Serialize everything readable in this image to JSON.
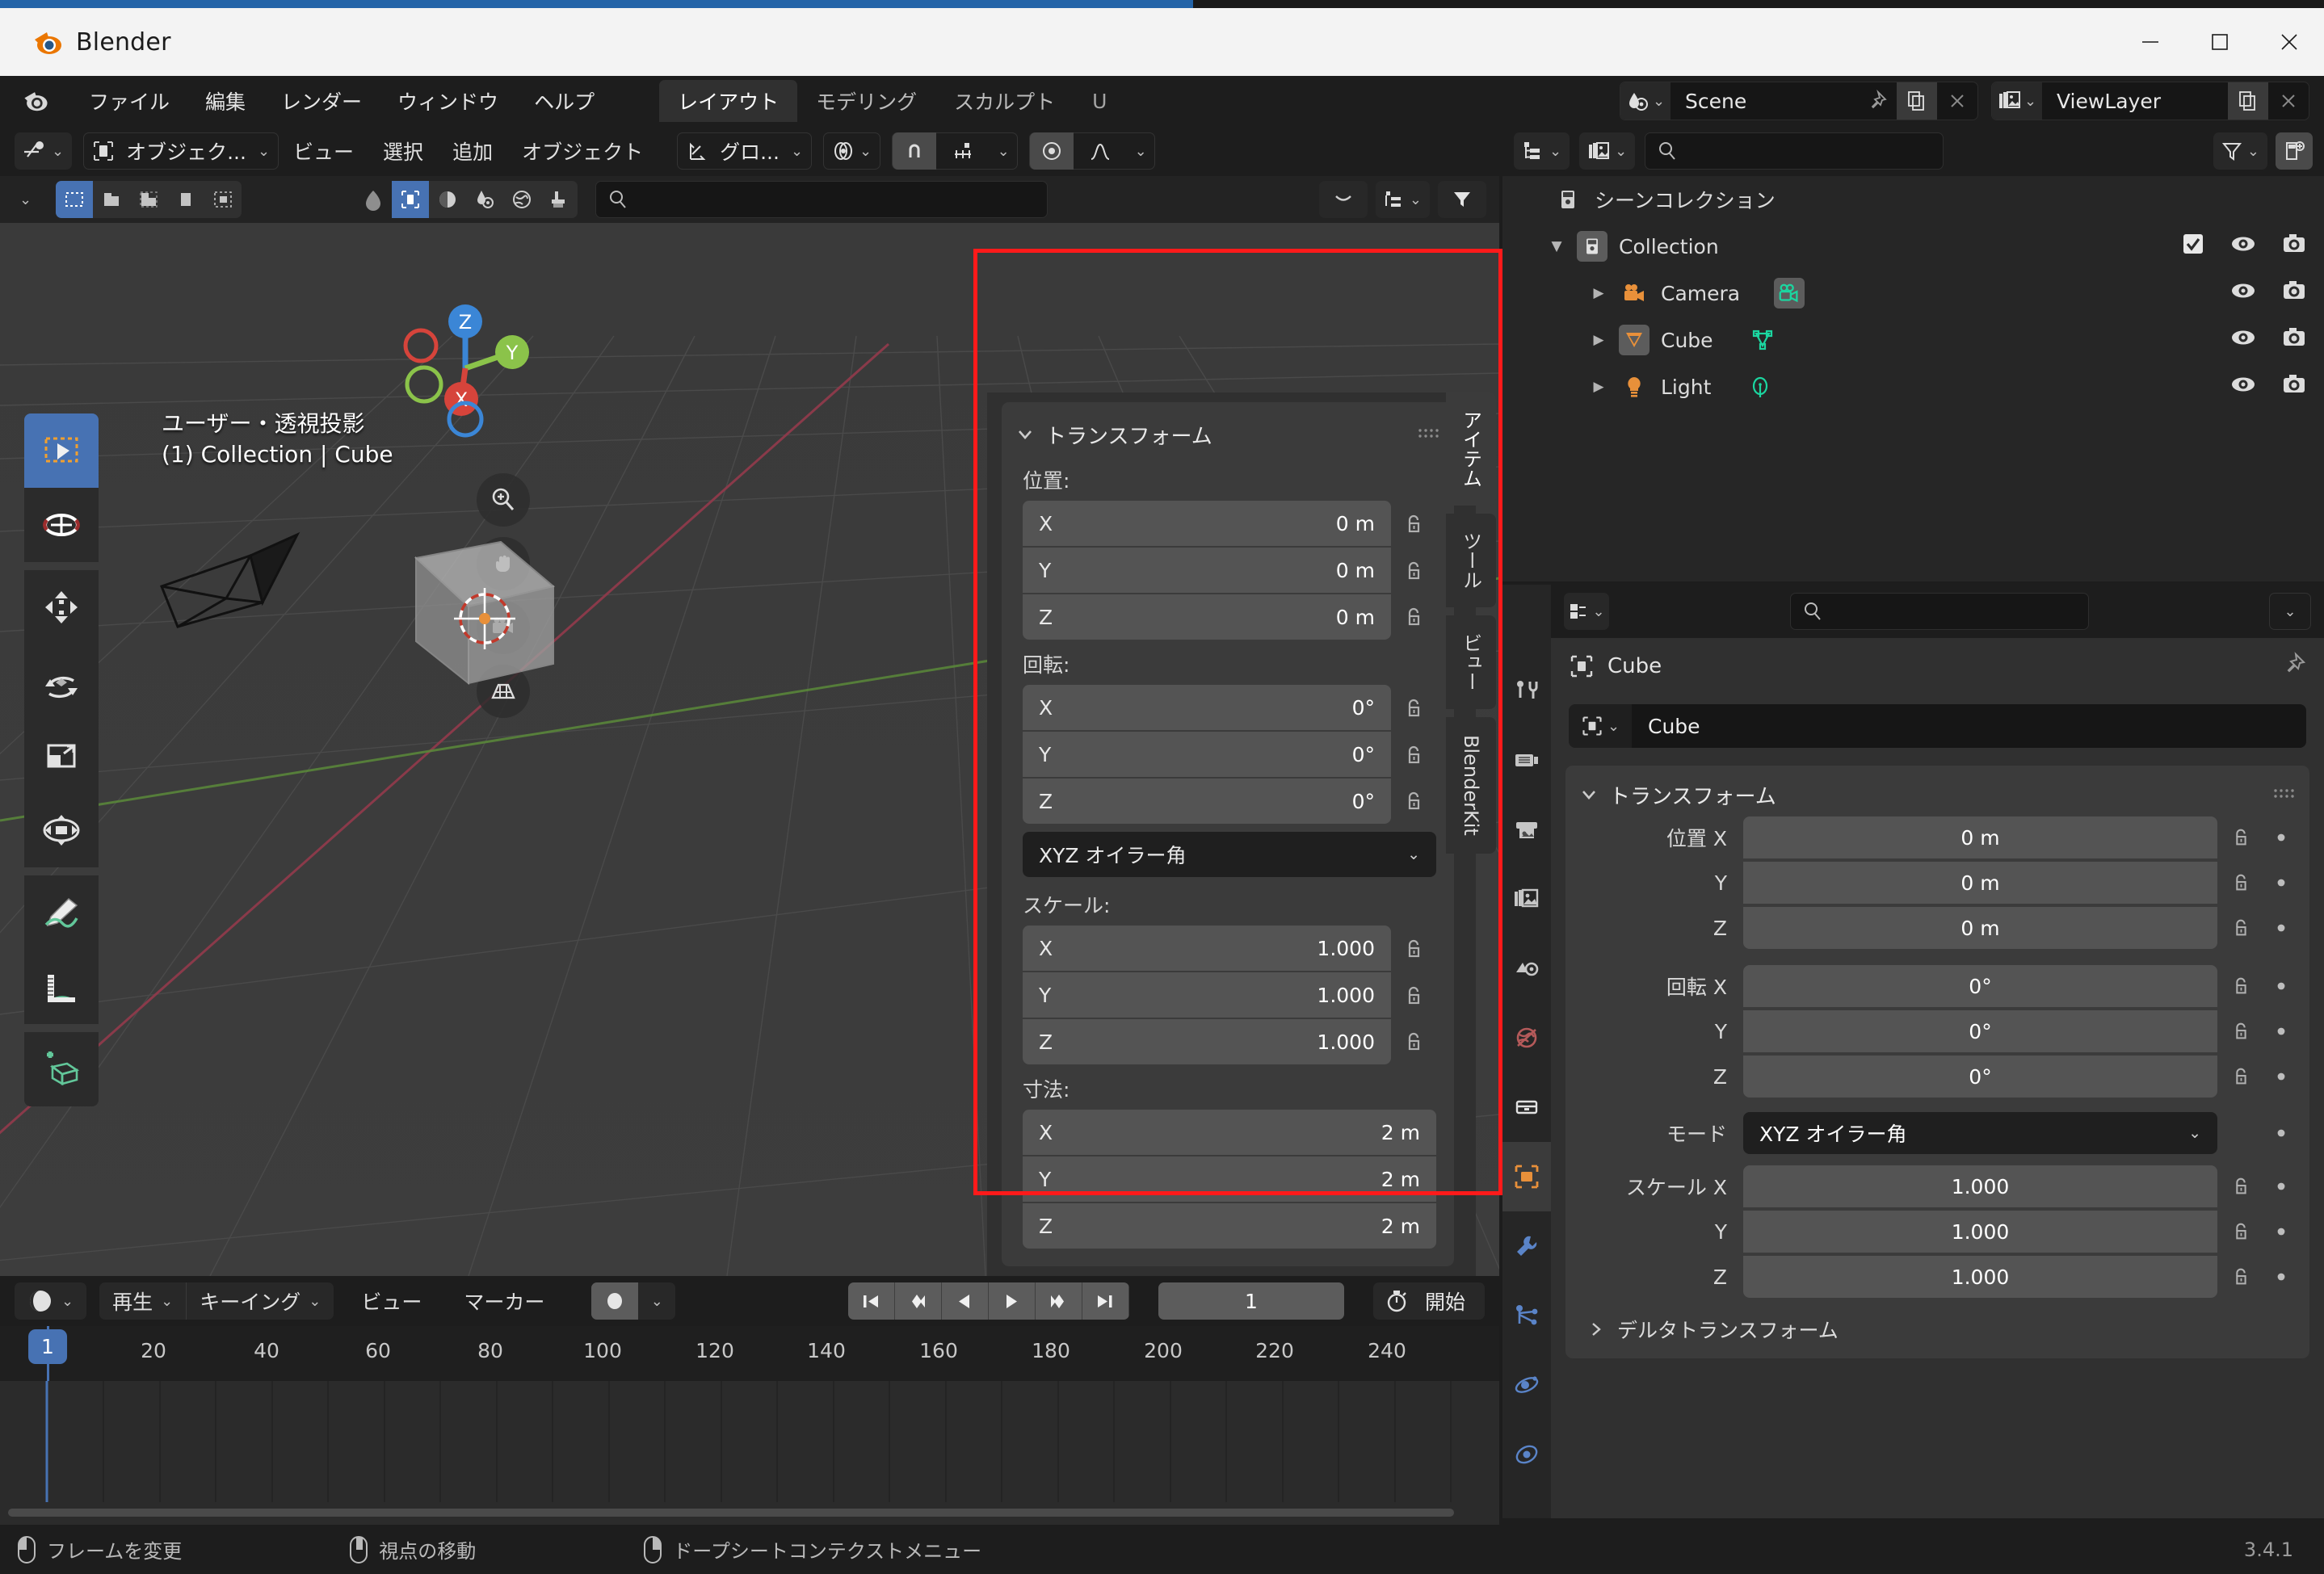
{
  "window": {
    "title": "Blender",
    "controls": {
      "minimize": "minimize-button",
      "maximize": "maximize-button",
      "close": "close-button"
    }
  },
  "topbar": {
    "menus": [
      "ファイル",
      "編集",
      "レンダー",
      "ウィンドウ",
      "ヘルプ"
    ],
    "workspace_tabs": [
      {
        "label": "レイアウト",
        "active": true
      },
      {
        "label": "モデリング",
        "active": false
      },
      {
        "label": "スカルプト",
        "active": false
      },
      {
        "label": "U",
        "active": false
      }
    ],
    "scene": {
      "label": "Scene",
      "icon": "scene-icon"
    },
    "viewlayer": {
      "label": "ViewLayer",
      "icon": "viewlayer-icon"
    }
  },
  "viewport": {
    "mode_selector": "オブジェク...",
    "menus": [
      "ビュー",
      "選択",
      "追加",
      "オブジェクト"
    ],
    "transform_orientation": "グロ...",
    "overlay_text_line1": "ユーザー・透視投影",
    "overlay_text_line2": "(1) Collection | Cube",
    "gizmo_axes": [
      "Z",
      "Y",
      "X"
    ],
    "tools": [
      "tweak-tool",
      "cursor-tool",
      "move-tool",
      "rotate-tool",
      "scale-tool",
      "transform-tool",
      "annotate-tool",
      "measure-tool",
      "add-cube-tool"
    ],
    "nav_buttons": [
      "zoom-icon",
      "pan-hand-icon",
      "camera-view-icon",
      "ortho-persp-icon"
    ],
    "sidebar_tabs": [
      {
        "label": "アイテム",
        "active": true
      },
      {
        "label": "ツール",
        "active": false
      },
      {
        "label": "ビュー",
        "active": false
      },
      {
        "label": "BlenderKit",
        "active": false
      }
    ]
  },
  "npanel": {
    "title": "トランスフォーム",
    "sections": [
      {
        "label": "位置:",
        "rows": [
          {
            "axis": "X",
            "value": "0 m"
          },
          {
            "axis": "Y",
            "value": "0 m"
          },
          {
            "axis": "Z",
            "value": "0 m"
          }
        ]
      },
      {
        "label": "回転:",
        "rows": [
          {
            "axis": "X",
            "value": "0°"
          },
          {
            "axis": "Y",
            "value": "0°"
          },
          {
            "axis": "Z",
            "value": "0°"
          }
        ]
      }
    ],
    "rotation_mode": "XYZ オイラー角",
    "scale": {
      "label": "スケール:",
      "rows": [
        {
          "axis": "X",
          "value": "1.000"
        },
        {
          "axis": "Y",
          "value": "1.000"
        },
        {
          "axis": "Z",
          "value": "1.000"
        }
      ]
    },
    "dimensions": {
      "label": "寸法:",
      "rows": [
        {
          "axis": "X",
          "value": "2 m"
        },
        {
          "axis": "Y",
          "value": "2 m"
        },
        {
          "axis": "Z",
          "value": "2 m"
        }
      ]
    }
  },
  "outliner": {
    "search_placeholder": "",
    "root": "シーンコレクション",
    "items": [
      {
        "label": "Collection",
        "icon": "collection-icon",
        "depth": 1,
        "expanded": true,
        "checkbox": true,
        "eye": true,
        "camera": true
      },
      {
        "label": "Camera",
        "icon": "camera-object-icon",
        "depth": 2,
        "expanded": false,
        "data_icon": "camera-data-icon",
        "eye": true,
        "camera": true
      },
      {
        "label": "Cube",
        "icon": "mesh-object-icon",
        "depth": 2,
        "expanded": false,
        "data_icon": "mesh-data-icon",
        "eye": true,
        "camera": true
      },
      {
        "label": "Light",
        "icon": "light-object-icon",
        "depth": 2,
        "expanded": false,
        "data_icon": "light-data-icon",
        "eye": true,
        "camera": true
      }
    ]
  },
  "properties": {
    "search_placeholder": "",
    "breadcrumb": "Cube",
    "object_name": "Cube",
    "panel_title": "トランスフォーム",
    "rows": [
      {
        "label": "位置 X",
        "value": "0 m",
        "pos": "top"
      },
      {
        "label": "Y",
        "value": "0 m",
        "pos": "mid"
      },
      {
        "label": "Z",
        "value": "0 m",
        "pos": "bot"
      },
      {
        "label": "回転 X",
        "value": "0°",
        "pos": "top"
      },
      {
        "label": "Y",
        "value": "0°",
        "pos": "mid"
      },
      {
        "label": "Z",
        "value": "0°",
        "pos": "bot"
      }
    ],
    "mode_label": "モード",
    "mode_value": "XYZ オイラー角",
    "scale_rows": [
      {
        "label": "スケール X",
        "value": "1.000",
        "pos": "top"
      },
      {
        "label": "Y",
        "value": "1.000",
        "pos": "mid"
      },
      {
        "label": "Z",
        "value": "1.000",
        "pos": "bot"
      }
    ],
    "delta_transform": "デルタトランスフォーム",
    "tabs": [
      "tool-tab",
      "render-tab",
      "output-tab",
      "viewlayer-tab",
      "scene-tab",
      "world-tab",
      "collection-tab",
      "object-tab",
      "modifier-tab",
      "particles-tab",
      "physics-tab",
      "constraint-tab"
    ]
  },
  "timeline": {
    "editor_icon": "timeline-editor-icon",
    "menus": [
      "再生",
      "キーイング",
      "ビュー",
      "マーカー"
    ],
    "playback_buttons": [
      "jump-start-icon",
      "prev-keyframe-icon",
      "play-reverse-icon",
      "play-icon",
      "next-keyframe-icon",
      "jump-end-icon"
    ],
    "current_frame": "1",
    "start_label": "開始",
    "ruler_ticks": [
      "20",
      "40",
      "60",
      "80",
      "100",
      "120",
      "140",
      "160",
      "180",
      "200",
      "220",
      "240"
    ],
    "playhead_frame": "1"
  },
  "statusbar": {
    "items": [
      {
        "mouse": "left",
        "label": "フレームを変更"
      },
      {
        "mouse": "middle",
        "label": "視点の移動"
      },
      {
        "mouse": "right",
        "label": "ドープシートコンテクストメニュー"
      }
    ],
    "version": "3.4.1"
  },
  "colors": {
    "accent_blue": "#4772b3",
    "highlight_red": "#ff1a1a",
    "orange": "#e8903a",
    "teal": "#1bd6a0",
    "panel_bg": "#3b3b3b",
    "field_bg": "#545454"
  }
}
